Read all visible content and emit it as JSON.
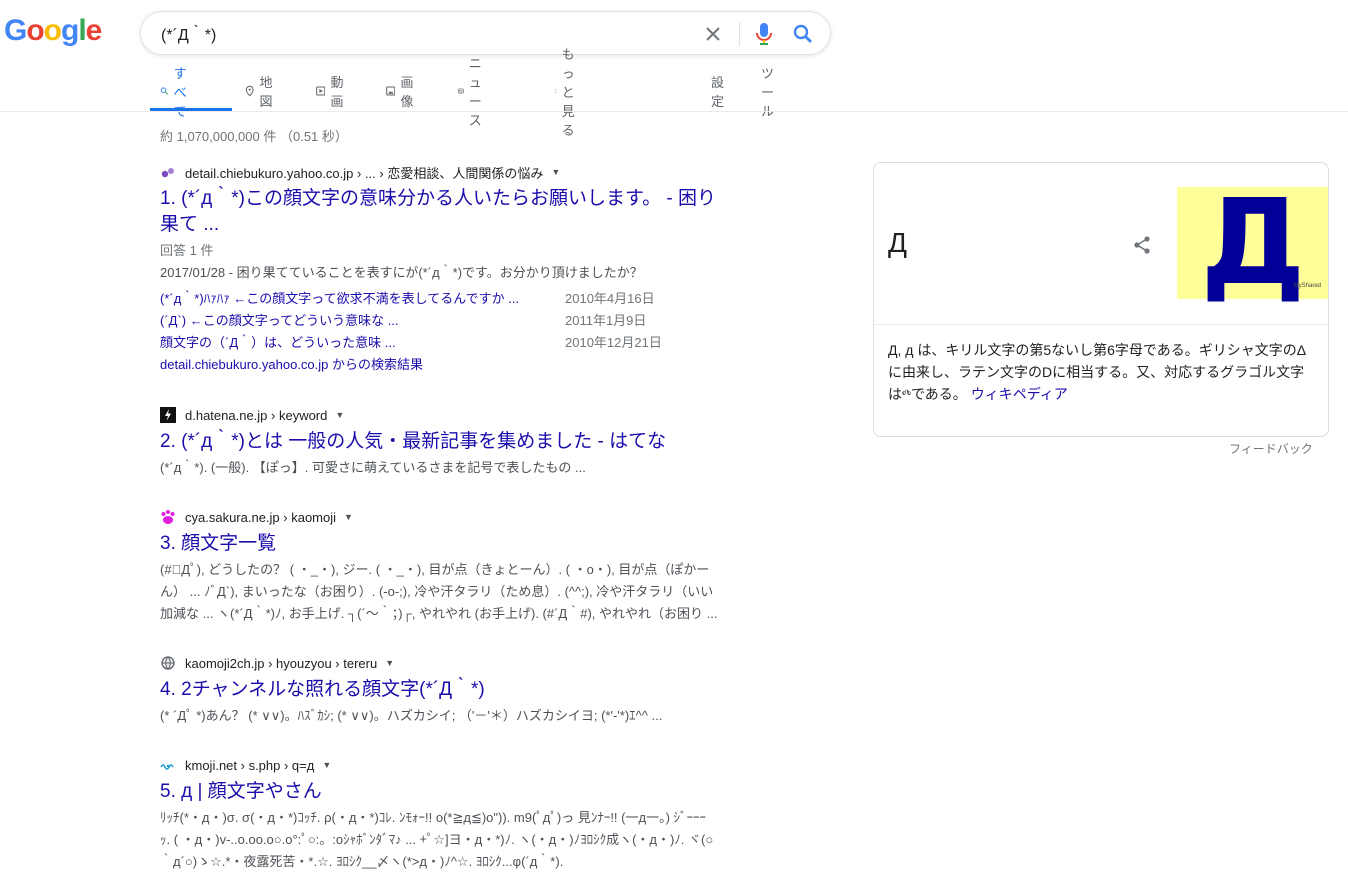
{
  "logo": "Google",
  "search": {
    "query": "(*´Д｀*)"
  },
  "tabs": [
    {
      "label": "すべて",
      "icon": "search-icon"
    },
    {
      "label": "地図",
      "icon": "map-pin-icon"
    },
    {
      "label": "動画",
      "icon": "video-icon"
    },
    {
      "label": "画像",
      "icon": "image-icon"
    },
    {
      "label": "ニュース",
      "icon": "news-icon"
    },
    {
      "label": "もっと見る",
      "icon": "more-vert-icon"
    },
    {
      "label": "設定"
    },
    {
      "label": "ツール"
    }
  ],
  "result_stats": "約 1,070,000,000 件 （0.51 秒）",
  "results": [
    {
      "cite": "detail.chiebukuro.yahoo.co.jp › ... › 恋愛相談、人間関係の悩み",
      "favicon": "chiebukuro-favicon",
      "title_line1": "1. (*´д｀*)この顔文字の意味分かる人いたらお願いします。 - 困り",
      "title_line2": "果て ...",
      "answers": "回答 1 件",
      "snippet": "2017/01/28 - 困り果てていることを表すにが(*´д｀*)です。お分かり頂けましたか？",
      "sublinks": [
        {
          "text": "(*´д｀*)ﾊｧﾊｧ ←この顔文字って欲求不満を表してるんですか ...",
          "date": "2010年4月16日"
        },
        {
          "text": "(´Д`) ←この顔文字ってどういう意味な ...",
          "date": "2011年1月9日"
        },
        {
          "text": "顔文字の（´Д｀）は、どういった意味 ...",
          "date": "2010年12月21日"
        }
      ],
      "more": "detail.chiebukuro.yahoo.co.jp からの検索結果"
    },
    {
      "cite": "d.hatena.ne.jp › keyword",
      "favicon": "hatena-favicon",
      "title": "2. (*´д｀*)とは 一般の人気・最新記事を集めました - はてな",
      "snippet": "(*´д｀*). (一般). 【ぽっ】. 可愛さに萌えているさまを記号で表したもの ..."
    },
    {
      "cite": "cya.sakura.ne.jp › kaomoji",
      "favicon": "paw-favicon",
      "title": "3. 顔文字一覧",
      "snippet1": "(#ﾟДﾟ), どうしたの？ ( ・_・), ジー. ( ・_・), 目が点（きょとーん）. ( ・o・), 目が点（ぽかー",
      "snippet2": "ん） ... ﾉﾞД`), まいったな（お困り）. (-o-;), 冷や汗タラリ（ため息）. (^^;), 冷や汗タラリ（いい",
      "snippet3": "加減な ... ヽ(*´Д｀*)ﾉ, お手上げ. ┐(´～｀；)┌, やれやれ (お手上げ). (#´Д｀#), やれやれ（お困り ..."
    },
    {
      "cite": "kaomoji2ch.jp › hyouzyou › tereru",
      "favicon": "globe-favicon",
      "title": "4. 2チャンネルな照れる顔文字(*´Д｀*)",
      "snippet": "(* ´Дﾟ *)あん？ (* ∨∨)。ﾊｽﾞｶｼ; (* ∨∨)。ハズカシイ; （'－'＊）ハズカシイヨ; (*'-'*)ｴ^^ ..."
    },
    {
      "cite": "kmoji.net › s.php › q=д",
      "favicon": "kmoji-favicon",
      "title": "5. д | 顔文字やさん",
      "snippet1": "ﾘｯﾁ(*・д・)σ. σ(・д・*)ｺｯﾁ. ρ(・д・*)ｺﾚ. ﾝﾓｫｰ!! o(*≧д≦)o\")). m9(ﾟдﾟ)っ 見ﾝﾅｰ!! (一д一。) ｼﾞｰｰｰ",
      "snippet2": "ｯ. ( ・д・)v-..o.oo.o○.o°:ﾟ○:。:oｼｬﾎﾞﾝﾀﾞﾏ♪ ... +ﾟ☆]ヨ・д・*)ﾉ. ヽ(・д・)ﾉﾖﾛｼｸ成ヽ(・д・)ﾉ. ヾ(○",
      "snippet3": "｀д´○)ゝ☆.*・夜露死苦・*.☆. ﾖﾛｼｸ__〆ヽ(*>д・)ﾉ^☆. ﾖﾛｼｸ...φ(´д｀*)."
    }
  ],
  "knowledge_panel": {
    "title": "Д",
    "image_letter": "Д",
    "image_tag": "MyShared",
    "description": "Д, д は、キリル文字の第5ないし第6字母である。ギリシャ文字のΔに由来し、ラテン文字のDに相当する。又、対応するグラゴル文字は",
    "description_glyph": "ⰴ",
    "description_tail": "である。",
    "wiki_link": "ウィキペディア"
  },
  "feedback": "フィードバック",
  "colors": {
    "link": "#1a0dab",
    "accent": "#1a73e8",
    "kp_image_bg": "#ffff99",
    "kp_image_letter": "#000099"
  }
}
